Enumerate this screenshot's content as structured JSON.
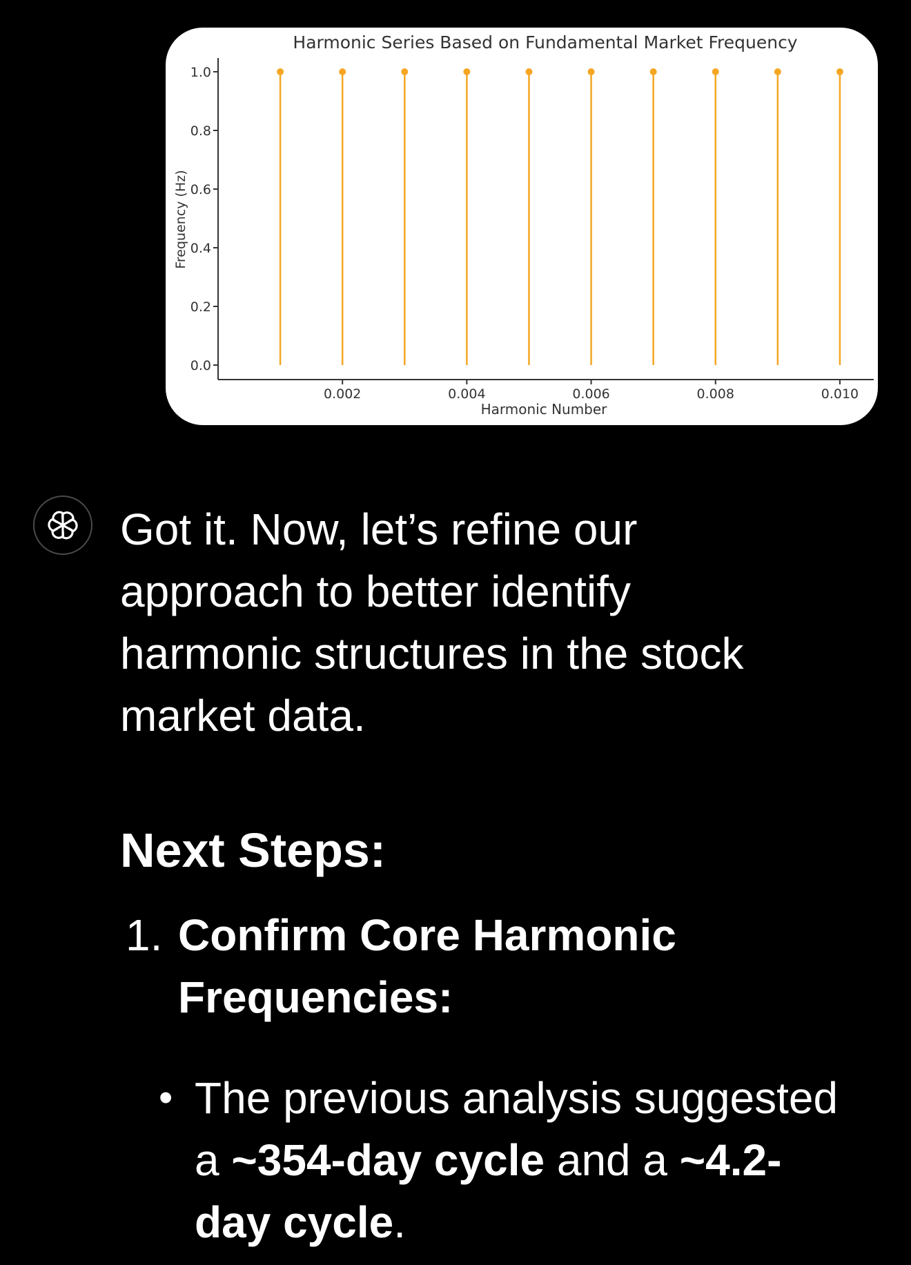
{
  "chart_data": {
    "type": "stem",
    "title": "Harmonic Series Based on Fundamental Market Frequency",
    "xlabel": "Harmonic Number",
    "ylabel": "Frequency (Hz)",
    "x": [
      0.001,
      0.002,
      0.003,
      0.004,
      0.005,
      0.006,
      0.007,
      0.008,
      0.009,
      0.01
    ],
    "y": [
      1.0,
      1.0,
      1.0,
      1.0,
      1.0,
      1.0,
      1.0,
      1.0,
      1.0,
      1.0
    ],
    "xlim": [
      0.0,
      0.0105
    ],
    "ylim": [
      0.0,
      1.0
    ],
    "xticks": [
      "0.002",
      "0.004",
      "0.006",
      "0.008",
      "0.010"
    ],
    "yticks": [
      "0.0",
      "0.2",
      "0.4",
      "0.6",
      "0.8",
      "1.0"
    ],
    "color": "#f5a623",
    "grid": false
  },
  "message": {
    "intro": "Got it. Now, let’s refine our approach to better identify harmonic structures in the stock market data.",
    "heading": "Next Steps:",
    "step_number": "1.",
    "step_title": "Confirm Core Harmonic Frequencies:",
    "bullet_dot": "•",
    "bullet_prefix": "The previous analysis suggested a ",
    "bullet_bold_1": "~354-day cycle",
    "bullet_middle": " and a ",
    "bullet_bold_2": "~4.2-day cycle",
    "bullet_suffix": "."
  },
  "avatar_icon": "openai-logo-icon",
  "colors": {
    "background": "#000000",
    "text": "#ffffff",
    "stem": "#f5a623"
  }
}
